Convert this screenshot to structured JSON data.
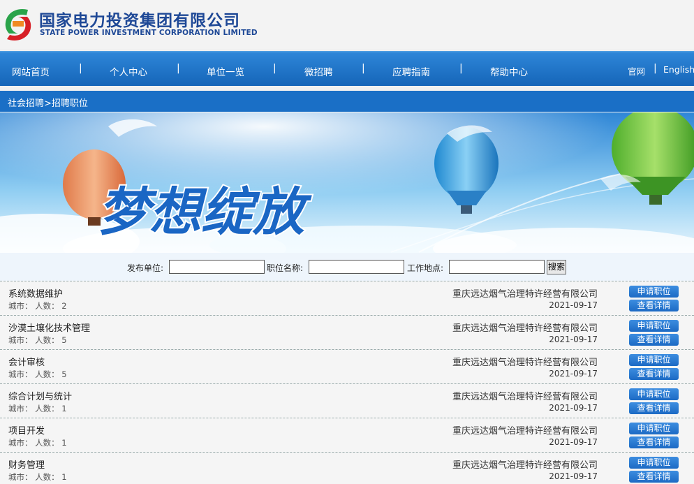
{
  "header": {
    "brand_cn": "国家电力投资集团有限公司",
    "brand_en": "STATE POWER INVESTMENT CORPORATION LIMITED"
  },
  "nav": {
    "items": [
      "网站首页",
      "个人中心",
      "单位一览",
      "微招聘",
      "应聘指南",
      "帮助中心"
    ],
    "separator": "|",
    "right": [
      "官网",
      "English"
    ]
  },
  "breadcrumb": "社会招聘>招聘职位",
  "banner": {
    "slogan": "梦想绽放"
  },
  "search": {
    "unit_label": "发布单位:",
    "position_label": "职位名称:",
    "location_label": "工作地点:",
    "button": "搜索"
  },
  "jobs": [
    {
      "title": "系统数据维护",
      "meta": "城市：  人数：  2",
      "company": "重庆远达烟气治理特许经营有限公司",
      "date": "2021-09-17"
    },
    {
      "title": "沙漠土壤化技术管理",
      "meta": "城市：  人数：  5",
      "company": "重庆远达烟气治理特许经营有限公司",
      "date": "2021-09-17"
    },
    {
      "title": "会计审核",
      "meta": "城市：  人数：  5",
      "company": "重庆远达烟气治理特许经营有限公司",
      "date": "2021-09-17"
    },
    {
      "title": "综合计划与统计",
      "meta": "城市：  人数：  1",
      "company": "重庆远达烟气治理特许经营有限公司",
      "date": "2021-09-17"
    },
    {
      "title": "项目开发",
      "meta": "城市：  人数：  1",
      "company": "重庆远达烟气治理特许经营有限公司",
      "date": "2021-09-17"
    },
    {
      "title": "财务管理",
      "meta": "城市：  人数：  1",
      "company": "重庆远达烟气治理特许经营有限公司",
      "date": "2021-09-17"
    }
  ],
  "actions": {
    "apply": "申请职位",
    "detail": "查看详情"
  },
  "colors": {
    "brand": "#1e4896",
    "nav": "#1a6fc6",
    "logo_red": "#d71f26",
    "logo_green": "#2aa34a"
  }
}
